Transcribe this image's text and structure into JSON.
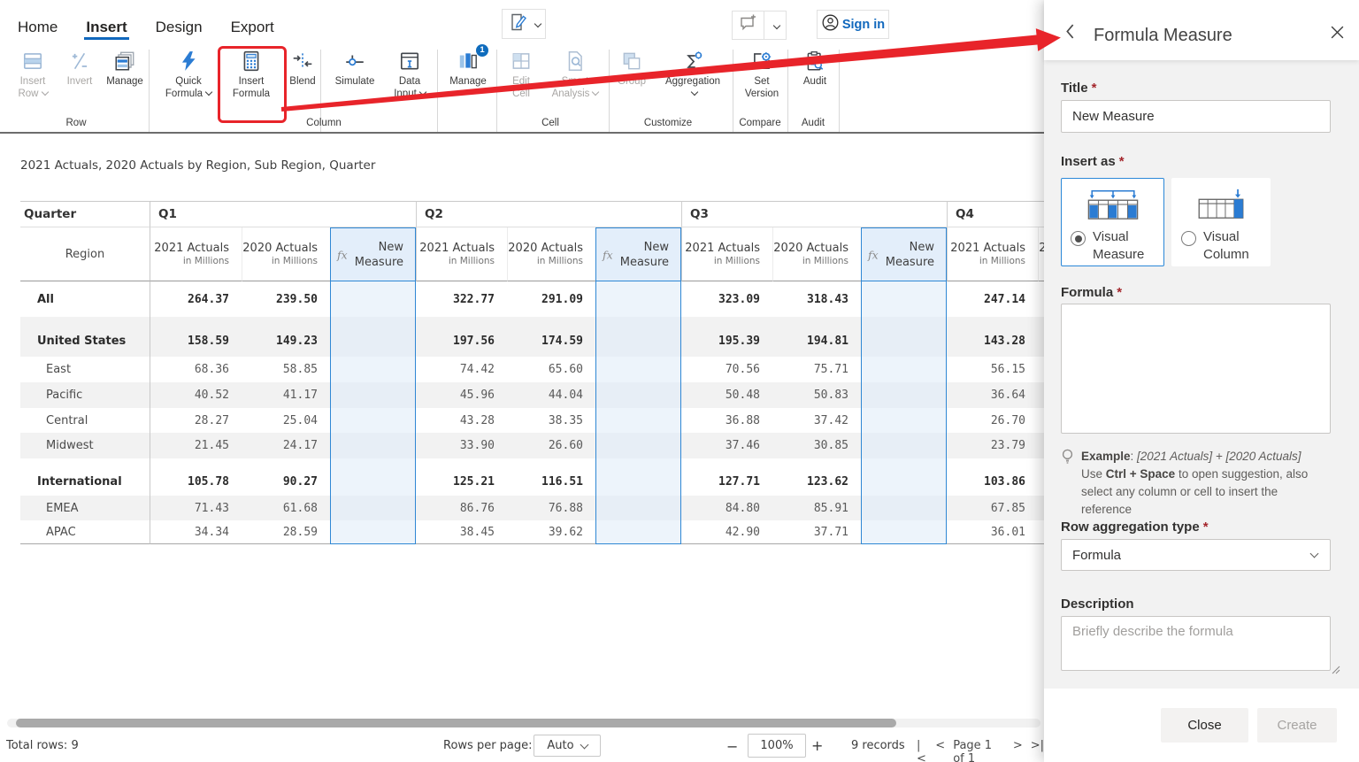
{
  "ribbon": {
    "tabs": [
      {
        "label": "Home",
        "active": false
      },
      {
        "label": "Insert",
        "active": true
      },
      {
        "label": "Design",
        "active": false
      },
      {
        "label": "Export",
        "active": false
      }
    ],
    "buttons": [
      {
        "id": "insert-row",
        "line1": "Insert",
        "line2": "Row",
        "chevron": true,
        "disabled": true,
        "icon": "insert-row"
      },
      {
        "id": "invert",
        "line1": "Invert",
        "line2": "",
        "chevron": false,
        "disabled": true,
        "icon": "invert"
      },
      {
        "id": "manage-row",
        "line1": "Manage",
        "line2": "",
        "chevron": false,
        "disabled": false,
        "icon": "manage-row"
      },
      {
        "id": "quick-formula",
        "line1": "Quick",
        "line2": "Formula",
        "chevron": true,
        "disabled": false,
        "icon": "quick-formula"
      },
      {
        "id": "insert-formula",
        "line1": "Insert",
        "line2": "Formula",
        "chevron": false,
        "disabled": false,
        "icon": "insert-formula"
      },
      {
        "id": "blend",
        "line1": "Blend",
        "line2": "",
        "chevron": false,
        "disabled": false,
        "icon": "blend"
      },
      {
        "id": "simulate",
        "line1": "Simulate",
        "line2": "",
        "chevron": false,
        "disabled": false,
        "icon": "simulate"
      },
      {
        "id": "data-input",
        "line1": "Data",
        "line2": "Input",
        "chevron": true,
        "disabled": false,
        "icon": "data-input"
      },
      {
        "id": "manage-column",
        "line1": "Manage",
        "line2": "",
        "chevron": false,
        "disabled": false,
        "icon": "manage-column",
        "badge": "1"
      },
      {
        "id": "edit-cell",
        "line1": "Edit",
        "line2": "Cell",
        "chevron": false,
        "disabled": true,
        "icon": "edit-cell"
      },
      {
        "id": "smart-analysis",
        "line1": "Smart",
        "line2": "Analysis",
        "chevron": true,
        "disabled": true,
        "icon": "smart-analysis"
      },
      {
        "id": "group",
        "line1": "Group",
        "line2": "",
        "chevron": false,
        "disabled": true,
        "icon": "group"
      },
      {
        "id": "aggregation",
        "line1": "Aggregation",
        "line2": "",
        "chevron": true,
        "disabled": false,
        "icon": "aggregation"
      },
      {
        "id": "set-version",
        "line1": "Set",
        "line2": "Version",
        "chevron": false,
        "disabled": false,
        "icon": "set-version"
      },
      {
        "id": "audit",
        "line1": "Audit",
        "line2": "",
        "chevron": false,
        "disabled": false,
        "icon": "audit"
      }
    ],
    "group_labels": [
      "Row",
      "Column",
      "Cell",
      "Customize",
      "Compare",
      "Audit"
    ],
    "sign_in": "Sign in"
  },
  "viz_title": "2021 Actuals, 2020 Actuals by Region, Sub Region, Quarter",
  "table": {
    "corner": "Quarter",
    "row_dim": "Region",
    "quarters": [
      "Q1",
      "Q2",
      "Q3",
      "Q4"
    ],
    "col_2021": "2021 Actuals",
    "col_2020": "2020 Actuals",
    "col_sub": "in Millions",
    "fx": "fx",
    "new_measure_line1": "New",
    "new_measure_line2": "Measure",
    "rows": [
      {
        "name": "All",
        "level": 0,
        "bold": true,
        "values": [
          "264.37",
          "239.50",
          "322.77",
          "291.09",
          "323.09",
          "318.43",
          "247.14"
        ]
      },
      {
        "name": "United States",
        "level": 1,
        "bold": true,
        "values": [
          "158.59",
          "149.23",
          "197.56",
          "174.59",
          "195.39",
          "194.81",
          "143.28"
        ]
      },
      {
        "name": "East",
        "level": 2,
        "bold": false,
        "values": [
          "68.36",
          "58.85",
          "74.42",
          "65.60",
          "70.56",
          "75.71",
          "56.15"
        ]
      },
      {
        "name": "Pacific",
        "level": 2,
        "bold": false,
        "values": [
          "40.52",
          "41.17",
          "45.96",
          "44.04",
          "50.48",
          "50.83",
          "36.64"
        ]
      },
      {
        "name": "Central",
        "level": 2,
        "bold": false,
        "values": [
          "28.27",
          "25.04",
          "43.28",
          "38.35",
          "36.88",
          "37.42",
          "26.70"
        ]
      },
      {
        "name": "Midwest",
        "level": 2,
        "bold": false,
        "values": [
          "21.45",
          "24.17",
          "33.90",
          "26.60",
          "37.46",
          "30.85",
          "23.79"
        ]
      },
      {
        "name": "International",
        "level": 1,
        "bold": true,
        "values": [
          "105.78",
          "90.27",
          "125.21",
          "116.51",
          "127.71",
          "123.62",
          "103.86"
        ]
      },
      {
        "name": "EMEA",
        "level": 2,
        "bold": false,
        "values": [
          "71.43",
          "61.68",
          "86.76",
          "76.88",
          "84.80",
          "85.91",
          "67.85"
        ]
      },
      {
        "name": "APAC",
        "level": 2,
        "bold": false,
        "values": [
          "34.34",
          "28.59",
          "38.45",
          "39.62",
          "42.90",
          "37.71",
          "36.01"
        ]
      }
    ]
  },
  "status_bar": {
    "total_rows_label": "Total rows:",
    "total_rows_value": "9",
    "rows_per_page_label": "Rows per page:",
    "rows_per_page_value": "Auto",
    "zoom_out": "−",
    "zoom_value": "100%",
    "zoom_in": "+",
    "records": "9 records",
    "pager_first": "|<",
    "pager_prev": "<",
    "pager_label": "Page 1 of 1",
    "pager_next": ">",
    "pager_last": ">|"
  },
  "panel": {
    "title": "Formula Measure",
    "required_mark": "*",
    "title_field": {
      "label": "Title",
      "value": "New Measure"
    },
    "insert_as": {
      "label": "Insert as",
      "options": [
        {
          "line1": "Visual",
          "line2": "Measure",
          "selected": true
        },
        {
          "line1": "Visual",
          "line2": "Column",
          "selected": false
        }
      ]
    },
    "formula_field": {
      "label": "Formula",
      "value": ""
    },
    "hint": {
      "example_label": "Example",
      "separator": ": ",
      "example_value": "[2021 Actuals] + [2020 Actuals]",
      "tip_pre": "Use ",
      "key1": "Ctrl",
      "plus": " + ",
      "key2": "Space",
      "tip_post": " to open suggestion, also select any column or cell to insert the reference"
    },
    "row_agg": {
      "label": "Row aggregation type",
      "value": "Formula"
    },
    "description": {
      "label": "Description",
      "placeholder": "Briefly describe the formula"
    },
    "close_label": "Close",
    "create_label": "Create"
  }
}
